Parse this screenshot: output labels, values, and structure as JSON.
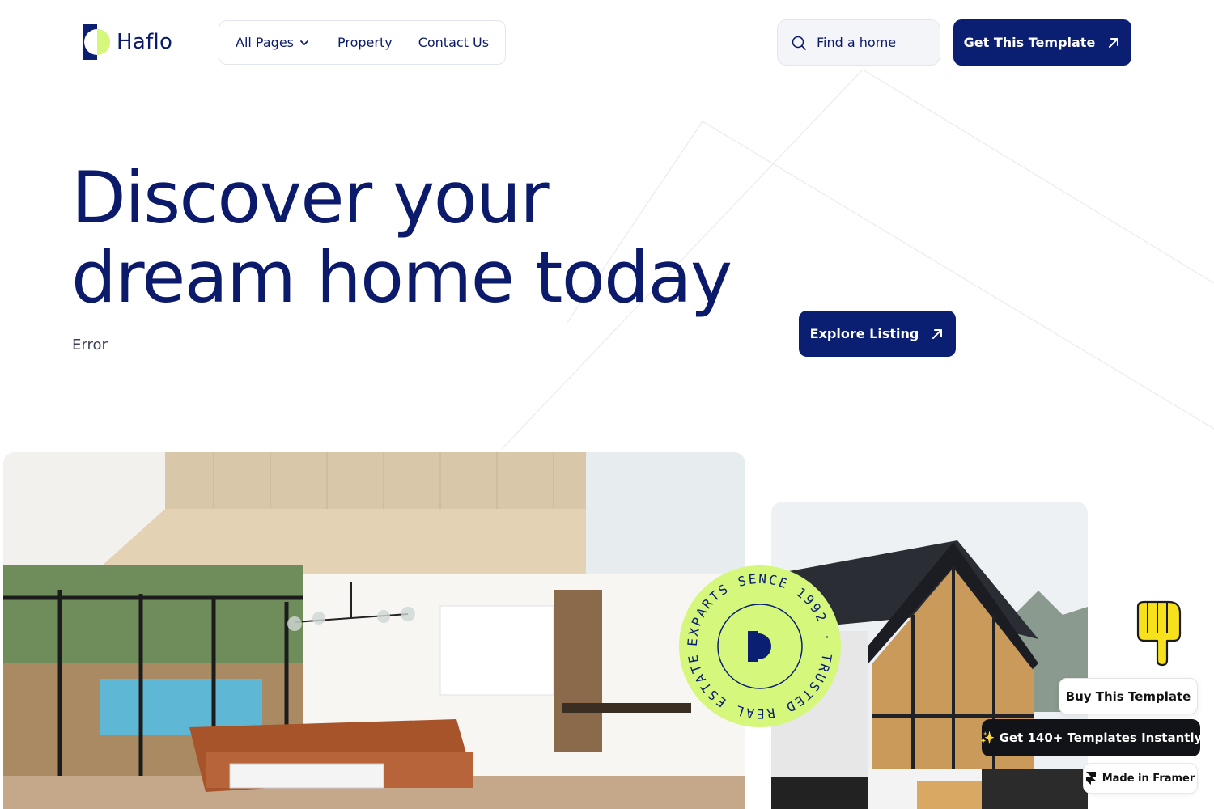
{
  "brand": {
    "name": "Haflo",
    "accent": "#0a1e72",
    "highlight": "#d4f77c"
  },
  "nav": {
    "items": [
      {
        "label": "All Pages",
        "icon": "chevron-down-icon"
      },
      {
        "label": "Property"
      },
      {
        "label": "Contact Us"
      }
    ]
  },
  "search": {
    "placeholder": "Find a home",
    "icon": "search-icon"
  },
  "header": {
    "cta_label": "Get This Template",
    "cta_icon": "arrow-up-right-icon"
  },
  "hero": {
    "title_line1": "Discover your",
    "title_line2": "dream home today",
    "subtitle": "Error",
    "cta_label": "Explore Listing"
  },
  "badge": {
    "text": "EXPARTS SENCE 1992 · TRUSTED REAL ESTATE"
  },
  "floating": {
    "buy_label": "Buy This Template",
    "get_label": "✨ Get 140+ Templates Instantly",
    "framer_label": "Made in Framer"
  }
}
